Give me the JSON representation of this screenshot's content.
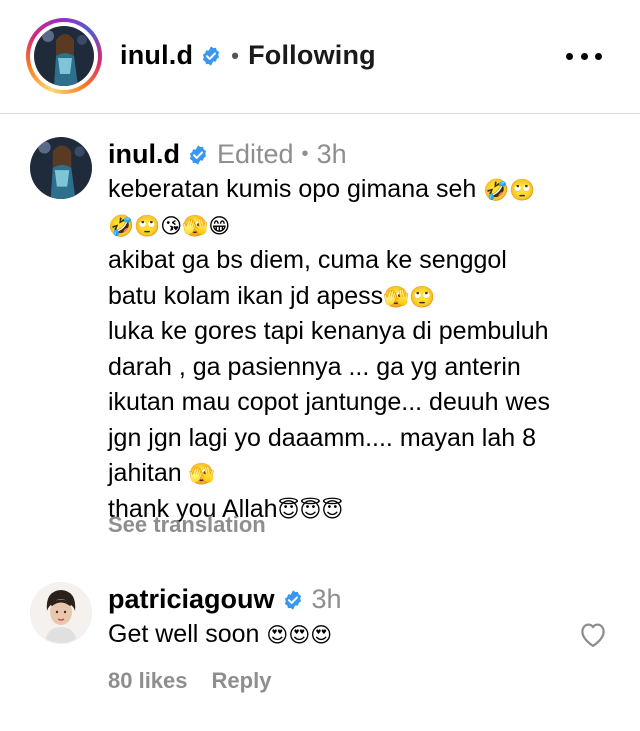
{
  "header": {
    "username": "inul.d",
    "separator": "•",
    "follow_status": "Following",
    "more_icon": "more-horizontal-icon"
  },
  "colors": {
    "verified_blue": "#3897f0",
    "meta_gray": "#8e8e8e",
    "divider": "#dbdbdb"
  },
  "main_comment": {
    "username": "inul.d",
    "edited": "Edited",
    "separator": "•",
    "time": "3h",
    "lines": [
      {
        "text": "keberatan kumis opo gimana seh ",
        "emoji": "🤣🙄"
      },
      {
        "text": "",
        "emoji": "🤣🙄😘🫣😁"
      },
      {
        "text": "akibat ga bs diem, cuma ke senggol",
        "emoji": ""
      },
      {
        "text": "batu kolam ikan jd apess",
        "emoji": "🫣🙄"
      },
      {
        "text": "luka ke gores tapi kenanya di pembuluh",
        "emoji": ""
      },
      {
        "text": "darah , ga pasiennya ... ga yg anterin",
        "emoji": ""
      },
      {
        "text": "ikutan mau copot jantunge... deuuh wes",
        "emoji": ""
      },
      {
        "text": "jgn jgn lagi yo daaamm.... mayan lah 8",
        "emoji": ""
      },
      {
        "text": "jahitan ",
        "emoji": "🫣"
      },
      {
        "text": "thank you  Allah",
        "emoji": "😇😇😇"
      }
    ],
    "see_translation": "See translation"
  },
  "reply": {
    "username": "patriciagouw",
    "time": "3h",
    "text": "Get well soon ",
    "emoji": "😍😍😍",
    "likes": "80 likes",
    "reply_label": "Reply",
    "like_icon": "heart-outline-icon"
  }
}
